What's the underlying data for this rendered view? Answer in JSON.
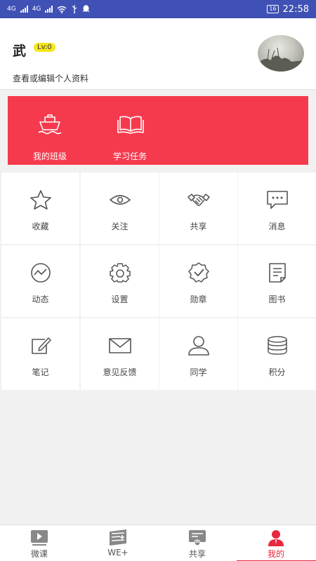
{
  "status_bar": {
    "network_labels": [
      "4G",
      "4G"
    ],
    "battery": "16",
    "time": "22:58",
    "icons": [
      "signal-icon",
      "signal-icon",
      "wifi-icon",
      "usb-icon",
      "qq-icon"
    ],
    "background": "#3f51b5"
  },
  "profile": {
    "name": "武",
    "level": "Lv:0",
    "edit_link": "查看或编辑个人资料"
  },
  "banner": {
    "background": "#f63a4e",
    "items": [
      {
        "label": "我的班级",
        "icon": "ship-icon"
      },
      {
        "label": "学习任务",
        "icon": "book-icon"
      }
    ]
  },
  "grid": {
    "items": [
      {
        "label": "收藏",
        "icon": "star-icon"
      },
      {
        "label": "关注",
        "icon": "eye-icon"
      },
      {
        "label": "共享",
        "icon": "handshake-icon"
      },
      {
        "label": "消息",
        "icon": "message-icon"
      },
      {
        "label": "动态",
        "icon": "activity-icon"
      },
      {
        "label": "设置",
        "icon": "gear-icon"
      },
      {
        "label": "勋章",
        "icon": "badge-icon"
      },
      {
        "label": "图书",
        "icon": "document-icon"
      },
      {
        "label": "笔记",
        "icon": "edit-icon"
      },
      {
        "label": "意见反馈",
        "icon": "mail-icon"
      },
      {
        "label": "同学",
        "icon": "person-icon"
      },
      {
        "label": "积分",
        "icon": "coins-icon"
      }
    ]
  },
  "tab_bar": {
    "active_color": "#e8283e",
    "items": [
      {
        "label": "微课",
        "icon": "video-icon",
        "active": false
      },
      {
        "label": "WE+",
        "icon": "we-plus-icon",
        "active": false
      },
      {
        "label": "共享",
        "icon": "share-box-icon",
        "active": false
      },
      {
        "label": "我的",
        "icon": "user-icon",
        "active": true
      }
    ]
  }
}
